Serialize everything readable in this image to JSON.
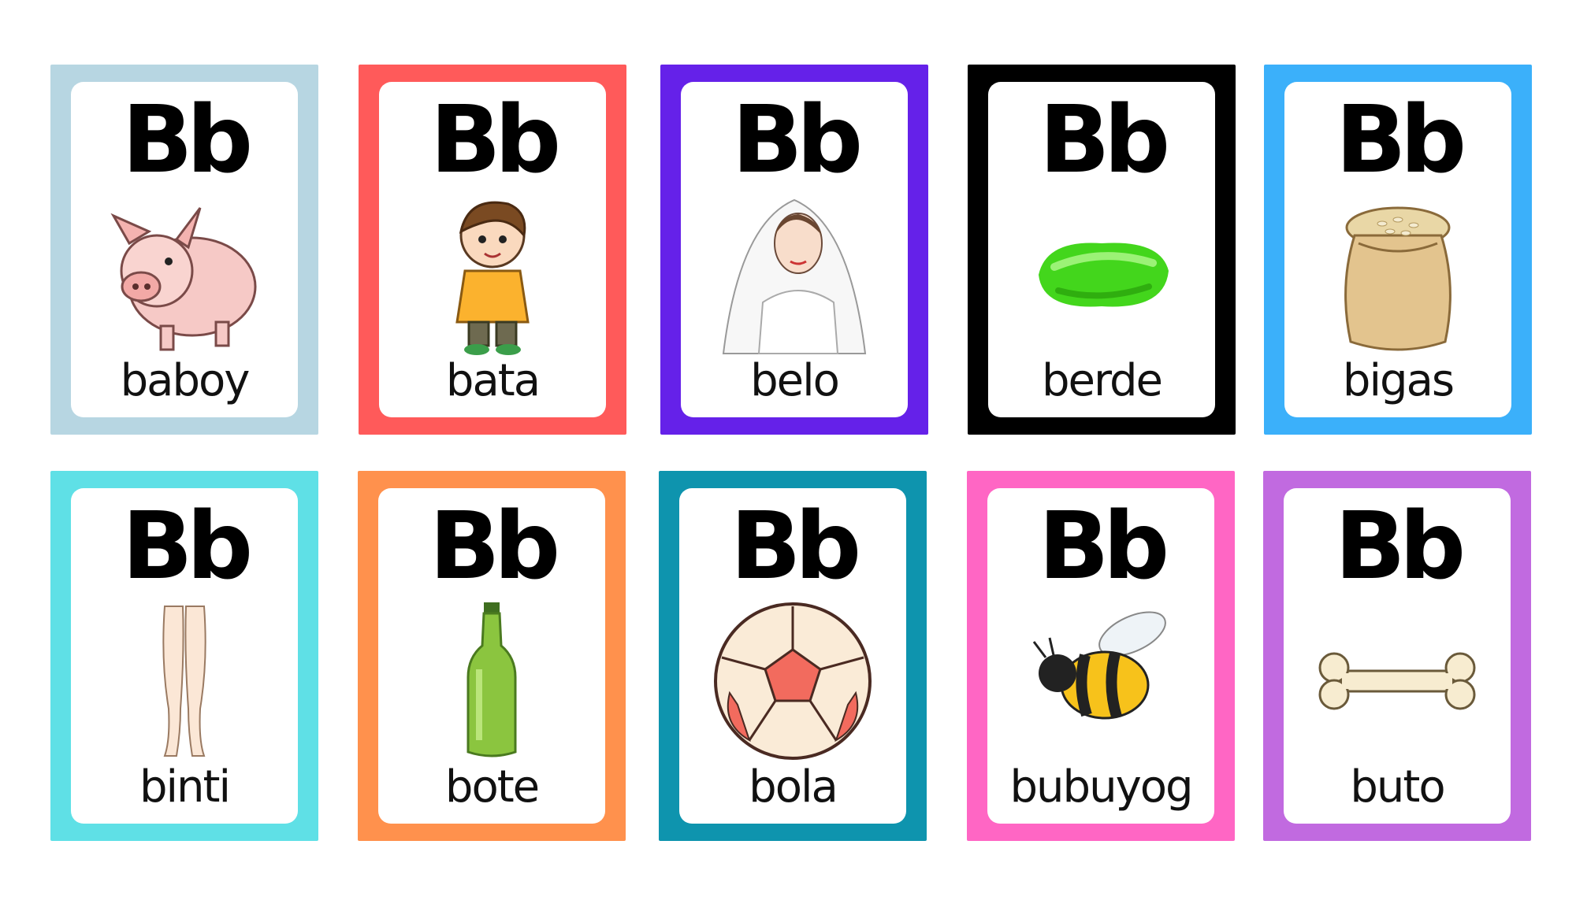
{
  "cards": [
    {
      "letter": "Bb",
      "word": "baboy",
      "picture": "pig-illustration",
      "border_color": "#B7D6E2"
    },
    {
      "letter": "Bb",
      "word": "bata",
      "picture": "child-illustration",
      "border_color": "#FF5A5A"
    },
    {
      "letter": "Bb",
      "word": "belo",
      "picture": "bride-veil-illustration",
      "border_color": "#6521E9"
    },
    {
      "letter": "Bb",
      "word": "berde",
      "picture": "green-paint-illustration",
      "border_color": "#000000"
    },
    {
      "letter": "Bb",
      "word": "bigas",
      "picture": "rice-sack-illustration",
      "border_color": "#3BB0FA"
    },
    {
      "letter": "Bb",
      "word": "binti",
      "picture": "legs-illustration",
      "border_color": "#5FE0E6"
    },
    {
      "letter": "Bb",
      "word": "bote",
      "picture": "bottle-illustration",
      "border_color": "#FF914D"
    },
    {
      "letter": "Bb",
      "word": "bola",
      "picture": "ball-illustration",
      "border_color": "#0E94AE"
    },
    {
      "letter": "Bb",
      "word": "bubuyog",
      "picture": "bee-illustration",
      "border_color": "#FF66C4"
    },
    {
      "letter": "Bb",
      "word": "buto",
      "picture": "bone-illustration",
      "border_color": "#C16AE0"
    }
  ]
}
